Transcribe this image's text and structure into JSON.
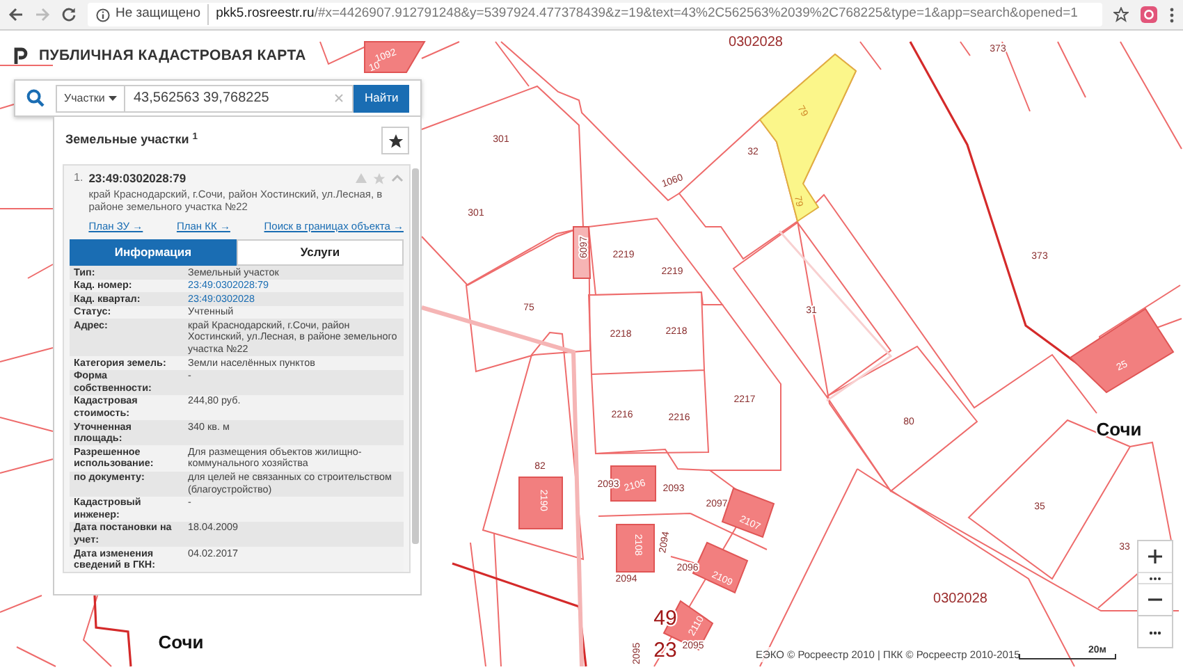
{
  "browser": {
    "status": "Не защищено",
    "url_host": "pkk5.rosreestr.ru",
    "url_rest": "/#x=4426907.912791248&y=5397924.477378439&z=19&text=43%2C562563%2039%2C768225&type=1&app=search&opened=1"
  },
  "app_title": "ПУБЛИЧНАЯ КАДАСТРОВАЯ КАРТА",
  "search": {
    "category": "Участки",
    "value": "43,562563 39,768225",
    "button": "Найти"
  },
  "results": {
    "title": "Земельные участки $^{1}$",
    "items": [
      {
        "index": "1.",
        "number": "23:49:0302028:79",
        "address": "край Краснодарский, г.Сочи, район Хостинский, ул.Лесная, в районе земельного участка №22",
        "expanded": true,
        "links": [
          "План ЗУ →",
          "План КК →",
          "Поиск в границах объекта →"
        ],
        "tabs": [
          {
            "label": "Информация",
            "selected": true
          },
          {
            "label": "Услуги",
            "selected": false
          }
        ],
        "info": [
          {
            "label": "Тип:",
            "value": "Земельный участок",
            "kind": "text"
          },
          {
            "label": "Кад. номер:",
            "value": "23:49:0302028:79",
            "kind": "link"
          },
          {
            "label": "Кад. квартал:",
            "value": "23:49:0302028",
            "kind": "link"
          },
          {
            "label": "Статус:",
            "value": "Учтенный",
            "kind": "text"
          },
          {
            "label": "Адрес:",
            "value": "край Краснодарский, г.Сочи, район Хостинский, ул.Лесная, в районе земельного участка №22",
            "kind": "text"
          },
          {
            "label": "Категория земель:",
            "value": "Земли населённых пунктов",
            "kind": "text"
          },
          {
            "label": "Форма собственности:",
            "value": "-",
            "kind": "text"
          },
          {
            "label": "Кадастровая стоимость:",
            "value": "244,80 руб.",
            "kind": "text"
          },
          {
            "label": "Уточненная площадь:",
            "value": "340 кв. м",
            "kind": "text"
          },
          {
            "label": "Разрешенное использование:",
            "value": "Для размещения объектов жилищно-коммунального хозяйства",
            "kind": "text"
          },
          {
            "label": "по документу:",
            "value": "для целей не связанных со строительством (благоустройство)",
            "kind": "text"
          },
          {
            "label": "Кадастровый инженер:",
            "value": "-",
            "kind": "text"
          },
          {
            "label": "Дата постановки на учет:",
            "value": "18.04.2009",
            "kind": "text"
          },
          {
            "label": "Дата изменения сведений в ГКН:",
            "value": "04.02.2017",
            "kind": "text"
          }
        ]
      }
    ]
  },
  "map_labels": [
    {
      "text": "0302028",
      "kind": "quarter"
    },
    {
      "text": "1092",
      "kind": "building"
    },
    {
      "text": "10",
      "kind": "building"
    },
    {
      "text": "373",
      "kind": "parcel"
    },
    {
      "text": "79",
      "kind": "selected"
    },
    {
      "text": "79",
      "kind": "selected"
    },
    {
      "text": "32",
      "kind": "parcel"
    },
    {
      "text": "1060",
      "kind": "parcel"
    },
    {
      "text": "301",
      "kind": "parcel"
    },
    {
      "text": "301",
      "kind": "parcel"
    },
    {
      "text": "6097",
      "kind": "parcel"
    },
    {
      "text": "2219",
      "kind": "parcel"
    },
    {
      "text": "2219",
      "kind": "parcel"
    },
    {
      "text": "373",
      "kind": "parcel"
    },
    {
      "text": "75",
      "kind": "parcel"
    },
    {
      "text": "31",
      "kind": "parcel"
    },
    {
      "text": "2218",
      "kind": "parcel"
    },
    {
      "text": "2218",
      "kind": "parcel"
    },
    {
      "text": "25",
      "kind": "building"
    },
    {
      "text": "2217",
      "kind": "parcel"
    },
    {
      "text": "2216",
      "kind": "parcel"
    },
    {
      "text": "2216",
      "kind": "parcel"
    },
    {
      "text": "80",
      "kind": "parcel"
    },
    {
      "text": "Сочи",
      "kind": "city"
    },
    {
      "text": "82",
      "kind": "parcel"
    },
    {
      "text": "2093",
      "kind": "parcel"
    },
    {
      "text": "2106",
      "kind": "building"
    },
    {
      "text": "2093",
      "kind": "parcel"
    },
    {
      "text": "2190",
      "kind": "building"
    },
    {
      "text": "2097",
      "kind": "parcel"
    },
    {
      "text": "2107",
      "kind": "building"
    },
    {
      "text": "2108",
      "kind": "building"
    },
    {
      "text": "2094",
      "kind": "parcel"
    },
    {
      "text": "35",
      "kind": "parcel"
    },
    {
      "text": "2096",
      "kind": "parcel"
    },
    {
      "text": "2109",
      "kind": "building"
    },
    {
      "text": "2094",
      "kind": "parcel"
    },
    {
      "text": "33",
      "kind": "parcel"
    },
    {
      "text": "0302028",
      "kind": "quarter"
    },
    {
      "text": "49",
      "kind": "district"
    },
    {
      "text": "2110",
      "kind": "building"
    },
    {
      "text": "Сочи",
      "kind": "city"
    },
    {
      "text": "2095",
      "kind": "parcel"
    },
    {
      "text": "23",
      "kind": "district"
    },
    {
      "text": "2095",
      "kind": "parcel"
    }
  ],
  "attribution": "ЕЭКО © Росреестр 2010 | ПКК © Росреестр 2010-2015",
  "scale": "20м"
}
